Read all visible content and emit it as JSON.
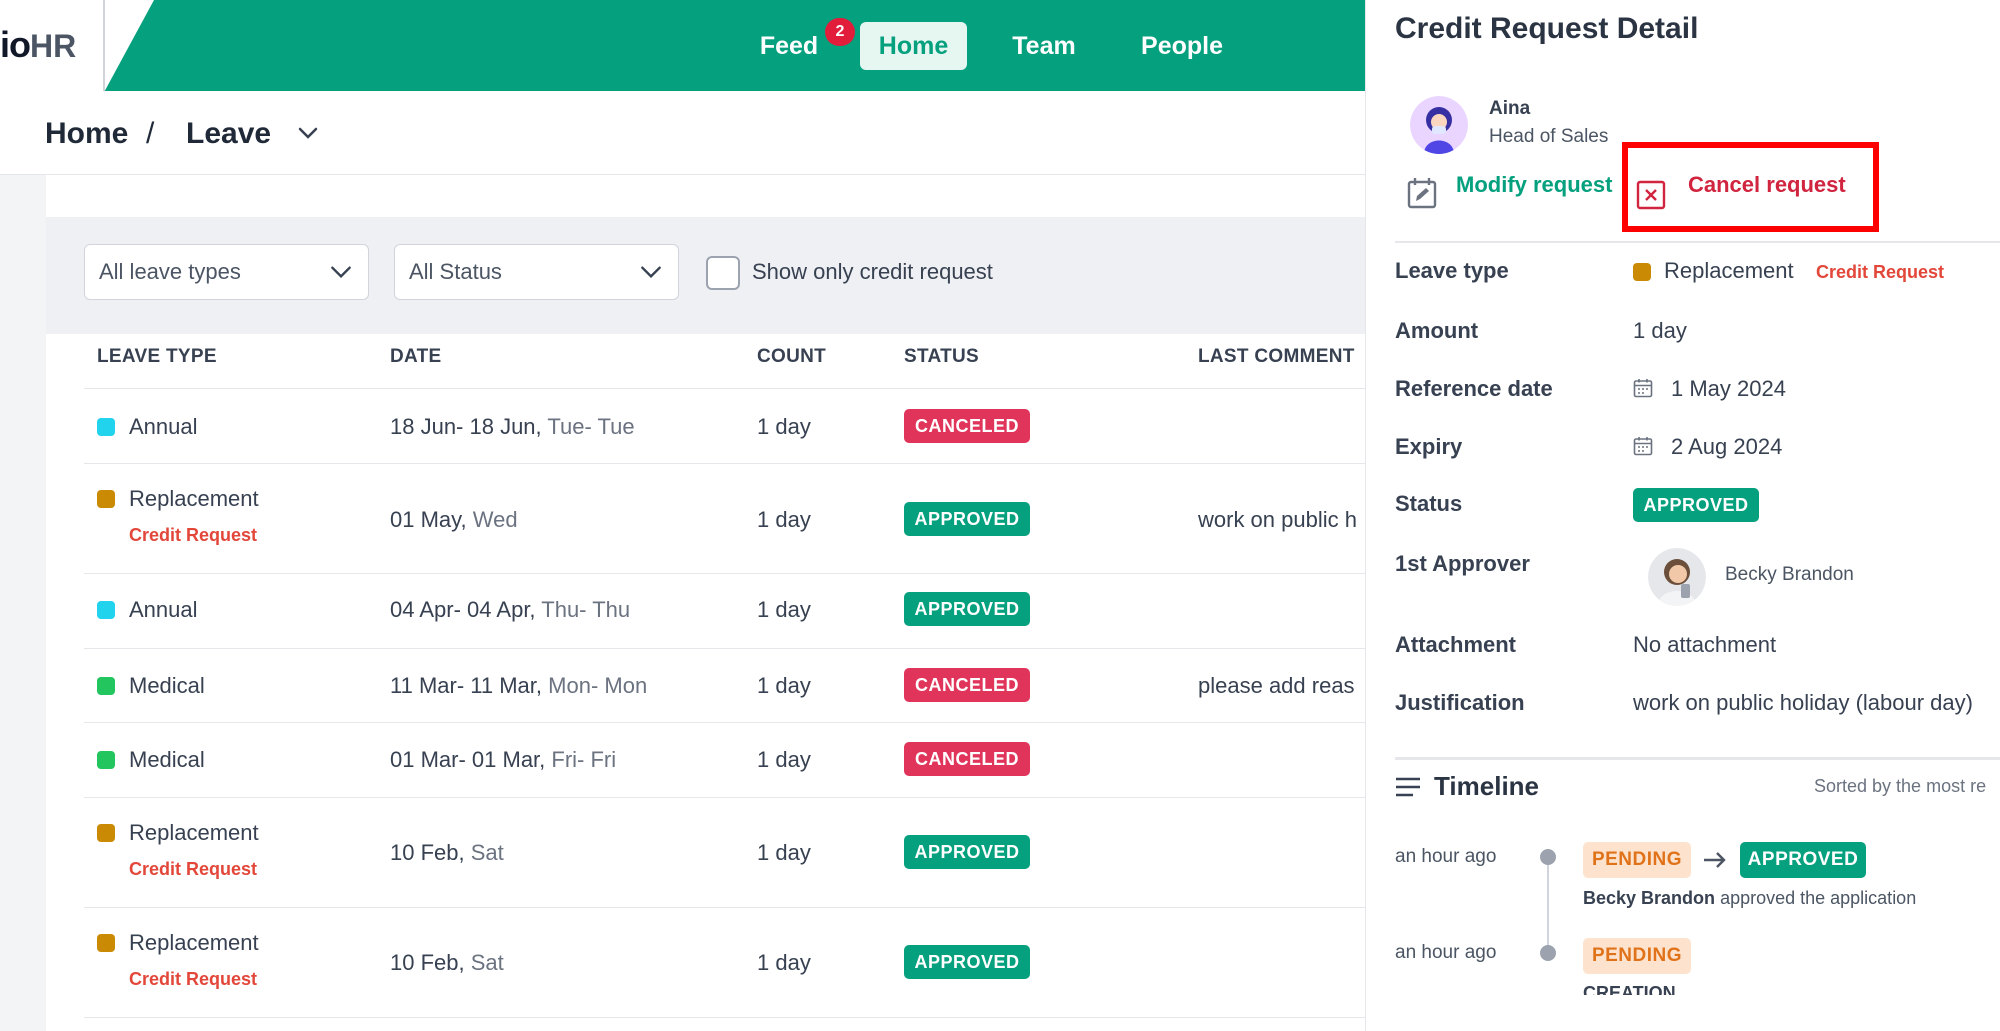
{
  "header": {
    "logo_main": "io",
    "logo_accent": "HR",
    "nav": [
      {
        "label": "Feed",
        "badge": "2"
      },
      {
        "label": "Home",
        "active": true
      },
      {
        "label": "Team"
      },
      {
        "label": "People"
      }
    ],
    "accent_color": "#05a07e"
  },
  "breadcrumb": {
    "home": "Home",
    "separator": "/",
    "current": "Leave"
  },
  "filters": {
    "leave_type": "All leave types",
    "status": "All Status",
    "credit_only_label": "Show only credit request"
  },
  "table": {
    "columns": [
      "LEAVE TYPE",
      "DATE",
      "COUNT",
      "STATUS",
      "LAST COMMENT"
    ],
    "rows": [
      {
        "type": "Annual",
        "color": "#22d3ee",
        "credit": "",
        "date": "18 Jun- 18 Jun,",
        "day": "Tue- Tue",
        "count": "1 day",
        "status": "CANCELED",
        "comment": ""
      },
      {
        "type": "Replacement",
        "color": "#ca8a04",
        "credit": "Credit Request",
        "date": "01 May,",
        "day": "Wed",
        "count": "1 day",
        "status": "APPROVED",
        "comment": "work on public h"
      },
      {
        "type": "Annual",
        "color": "#22d3ee",
        "credit": "",
        "date": "04 Apr- 04 Apr,",
        "day": "Thu- Thu",
        "count": "1 day",
        "status": "APPROVED",
        "comment": ""
      },
      {
        "type": "Medical",
        "color": "#22c55e",
        "credit": "",
        "date": "11 Mar- 11 Mar,",
        "day": "Mon- Mon",
        "count": "1 day",
        "status": "CANCELED",
        "comment": "please add reas"
      },
      {
        "type": "Medical",
        "color": "#22c55e",
        "credit": "",
        "date": "01 Mar- 01 Mar,",
        "day": "Fri- Fri",
        "count": "1 day",
        "status": "CANCELED",
        "comment": ""
      },
      {
        "type": "Replacement",
        "color": "#ca8a04",
        "credit": "Credit Request",
        "date": "10 Feb,",
        "day": "Sat",
        "count": "1 day",
        "status": "APPROVED",
        "comment": ""
      },
      {
        "type": "Replacement",
        "color": "#ca8a04",
        "credit": "Credit Request",
        "date": "10 Feb,",
        "day": "Sat",
        "count": "1 day",
        "status": "APPROVED",
        "comment": ""
      }
    ]
  },
  "drawer": {
    "title": "Credit Request Detail",
    "user": {
      "name": "Aina",
      "role": "Head of Sales"
    },
    "actions": {
      "modify": "Modify request",
      "cancel": "Cancel request"
    },
    "fields": {
      "leave_type_label": "Leave type",
      "leave_type_value": "Replacement",
      "leave_type_tag": "Credit Request",
      "amount_label": "Amount",
      "amount_value": "1 day",
      "reference_label": "Reference date",
      "reference_value": "1 May 2024",
      "expiry_label": "Expiry",
      "expiry_value": "2 Aug 2024",
      "status_label": "Status",
      "status_value": "APPROVED",
      "approver_label": "1st Approver",
      "approver_value": "Becky Brandon",
      "attachment_label": "Attachment",
      "attachment_value": "No attachment",
      "justification_label": "Justification",
      "justification_value": "work on public holiday (labour day)"
    },
    "timeline": {
      "title": "Timeline",
      "sort_note": "Sorted by the most re",
      "events": [
        {
          "time": "an hour ago",
          "from": "PENDING",
          "to": "APPROVED",
          "actor": "Becky Brandon",
          "text": "approved the application"
        },
        {
          "time": "an hour ago",
          "from": "PENDING",
          "note": "CREATION"
        }
      ]
    }
  }
}
